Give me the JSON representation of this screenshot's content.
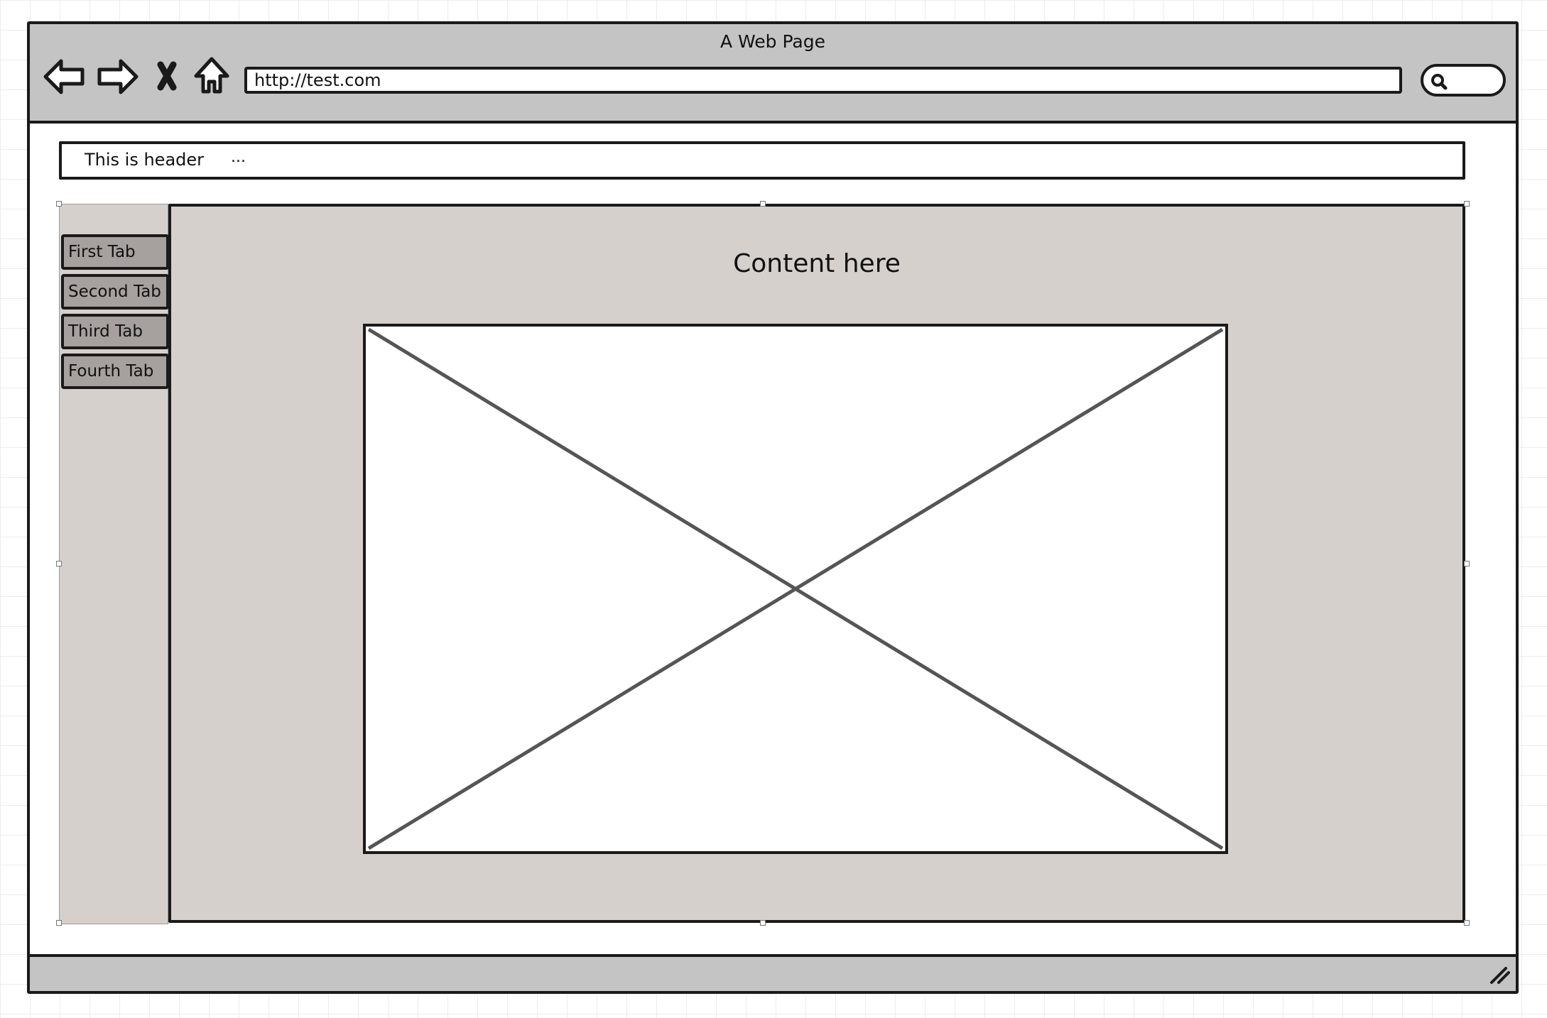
{
  "browser": {
    "title": "A Web Page",
    "url": "http://test.com",
    "nav_icons": [
      "back-arrow-icon",
      "forward-arrow-icon",
      "stop-icon",
      "home-icon"
    ],
    "search_icon": "search-icon"
  },
  "page": {
    "header": {
      "text": "This is header",
      "more": "..."
    },
    "tabs": [
      {
        "label": "First Tab"
      },
      {
        "label": "Second Tab"
      },
      {
        "label": "Third Tab"
      },
      {
        "label": "Fourth Tab"
      }
    ],
    "content": {
      "title": "Content here",
      "image_placeholder": "image-placeholder"
    }
  },
  "colors": {
    "chrome": "#c4c4c4",
    "panel": "#d6d0cd",
    "tab": "#a6a09e",
    "stroke": "#1a1a1a"
  }
}
